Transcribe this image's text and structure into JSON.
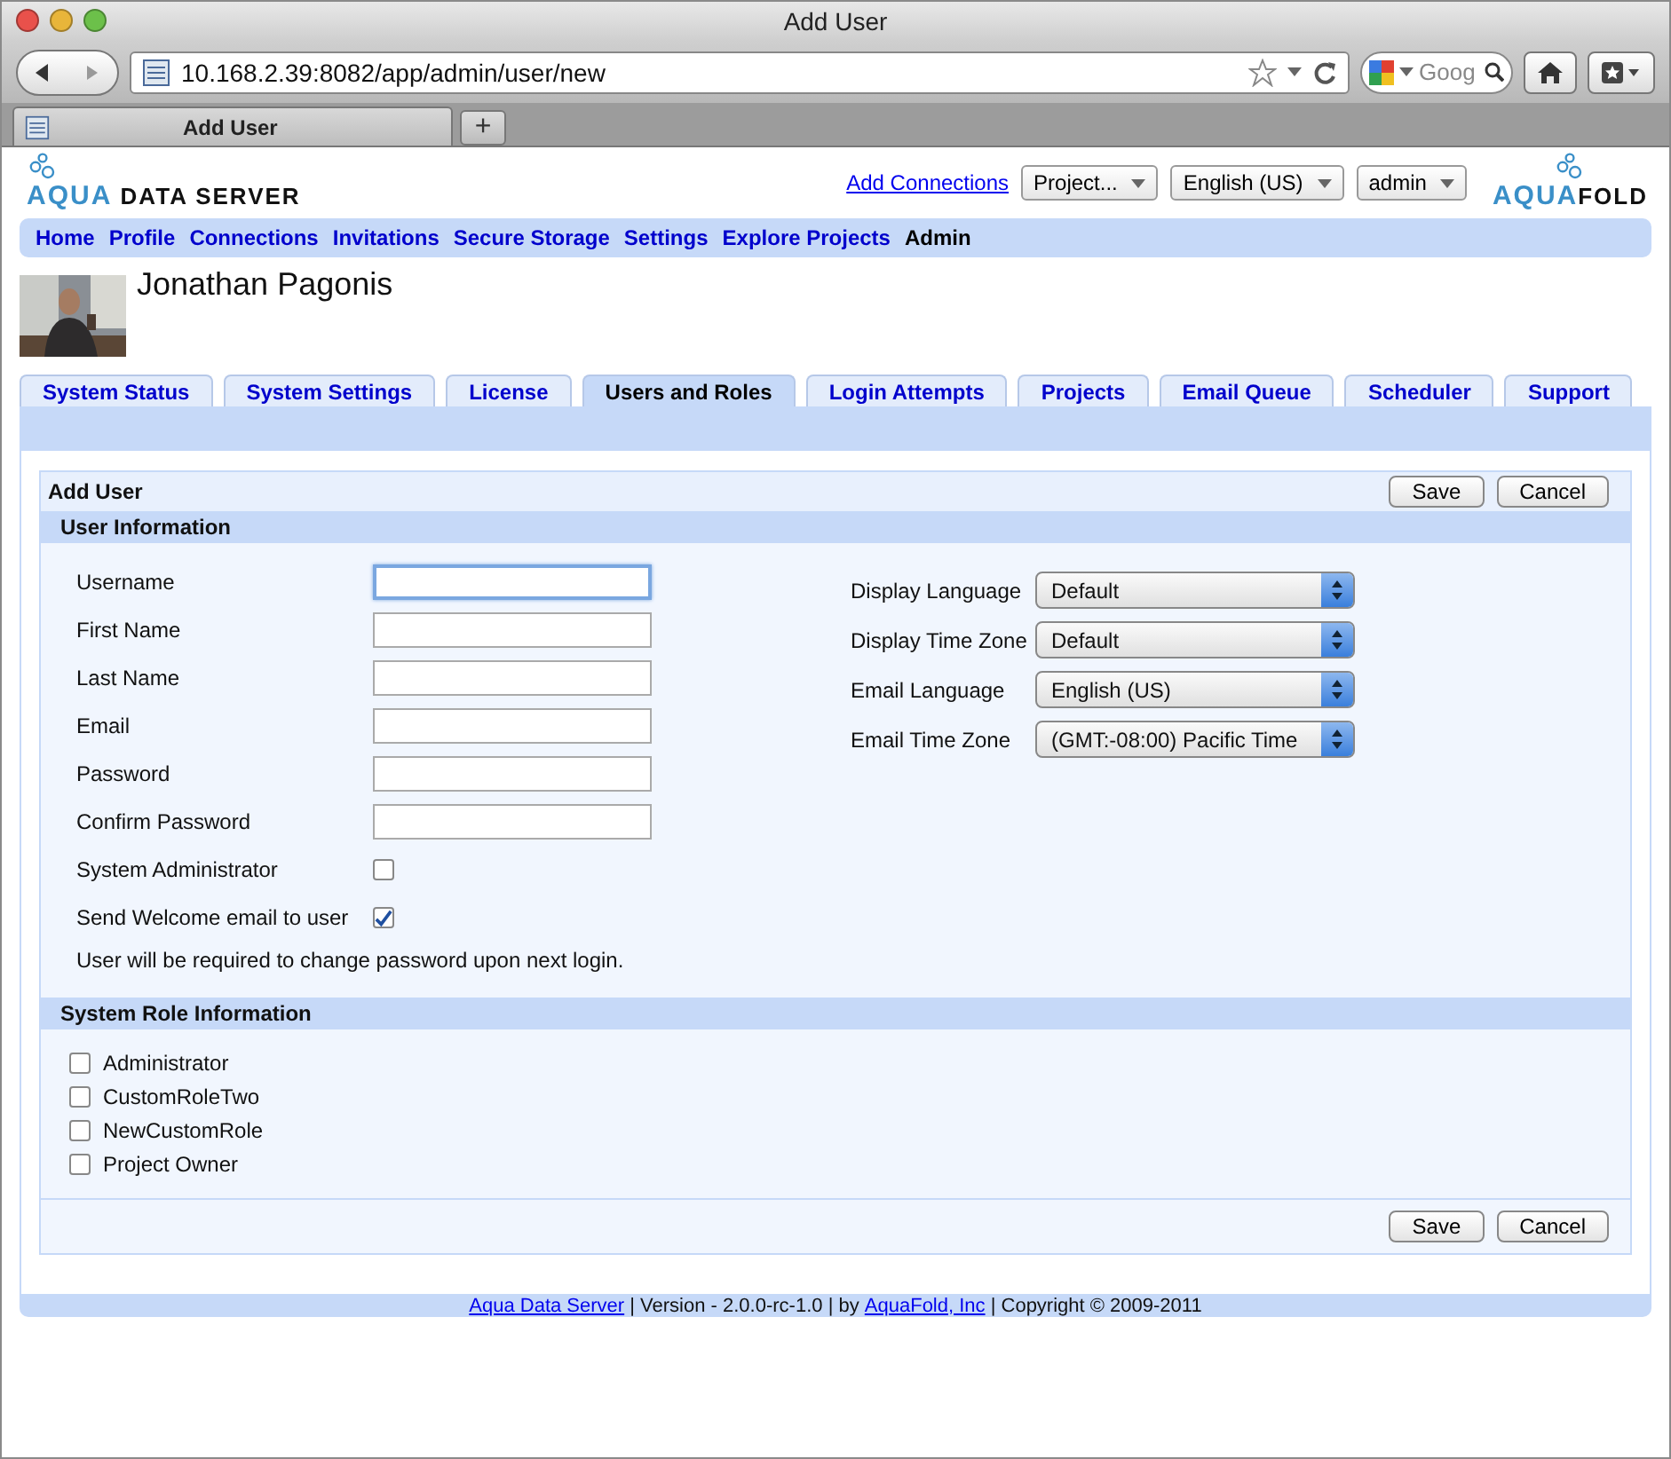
{
  "window": {
    "title": "Add User"
  },
  "toolbar": {
    "url": "10.168.2.39:8082/app/admin/user/new",
    "search_placeholder": "Goog"
  },
  "browser_tabs": [
    {
      "label": "Add User",
      "selected": true
    }
  ],
  "new_tab": "+",
  "header": {
    "logo_left": {
      "first": "AQUA",
      "second": " DATA SERVER"
    },
    "link": "Add Connections",
    "dropdowns": [
      "Project...",
      "English (US)",
      "admin"
    ],
    "logo_right": {
      "first": "AQUA",
      "second": "FOLD"
    }
  },
  "nav": [
    {
      "label": "Home",
      "selected": false
    },
    {
      "label": "Profile",
      "selected": false
    },
    {
      "label": "Connections",
      "selected": false
    },
    {
      "label": "Invitations",
      "selected": false
    },
    {
      "label": "Secure Storage",
      "selected": false
    },
    {
      "label": "Settings",
      "selected": false
    },
    {
      "label": "Explore Projects",
      "selected": false
    },
    {
      "label": "Admin",
      "selected": true
    }
  ],
  "user": {
    "name": "Jonathan Pagonis"
  },
  "admin_tabs": [
    {
      "label": "System Status",
      "selected": false
    },
    {
      "label": "System Settings",
      "selected": false
    },
    {
      "label": "License",
      "selected": false
    },
    {
      "label": "Users and Roles",
      "selected": true
    },
    {
      "label": "Login Attempts",
      "selected": false
    },
    {
      "label": "Projects",
      "selected": false
    },
    {
      "label": "Email Queue",
      "selected": false
    },
    {
      "label": "Scheduler",
      "selected": false
    },
    {
      "label": "Support",
      "selected": false
    }
  ],
  "form": {
    "title": "Add User",
    "buttons": [
      "Save",
      "Cancel"
    ],
    "user_section": {
      "title": "User Information",
      "fields": [
        {
          "kind": "text",
          "label": "Username",
          "focused": true
        },
        {
          "kind": "text",
          "label": "First Name",
          "focused": false
        },
        {
          "kind": "text",
          "label": "Last Name",
          "focused": false
        },
        {
          "kind": "text",
          "label": "Email",
          "focused": false
        },
        {
          "kind": "text",
          "label": "Password",
          "focused": false
        },
        {
          "kind": "text",
          "label": "Confirm Password",
          "focused": false
        },
        {
          "kind": "checkbox",
          "label": "System Administrator",
          "checked": false
        },
        {
          "kind": "checkbox",
          "label": "Send Welcome email to user",
          "checked": true
        }
      ],
      "note": "User will be required to change password upon next login.",
      "selects": [
        {
          "label": "Display Language",
          "value": "Default"
        },
        {
          "label": "Display Time Zone",
          "value": "Default"
        },
        {
          "label": "Email Language",
          "value": "English (US)"
        },
        {
          "label": "Email Time Zone",
          "value": "(GMT:-08:00) Pacific Time"
        }
      ]
    },
    "role_section": {
      "title": "System Role Information",
      "roles": [
        {
          "label": "Administrator",
          "checked": false
        },
        {
          "label": "CustomRoleTwo",
          "checked": false
        },
        {
          "label": "NewCustomRole",
          "checked": false
        },
        {
          "label": "Project Owner",
          "checked": false
        }
      ]
    },
    "bottom_buttons": [
      "Save",
      "Cancel"
    ]
  },
  "footer": [
    {
      "kind": "link",
      "text": "Aqua Data Server"
    },
    {
      "kind": "text",
      "text": " | Version - 2.0.0-rc-1.0 | by "
    },
    {
      "kind": "link",
      "text": "AquaFold, Inc"
    },
    {
      "kind": "text",
      "text": " | Copyright © 2009-2011"
    }
  ]
}
